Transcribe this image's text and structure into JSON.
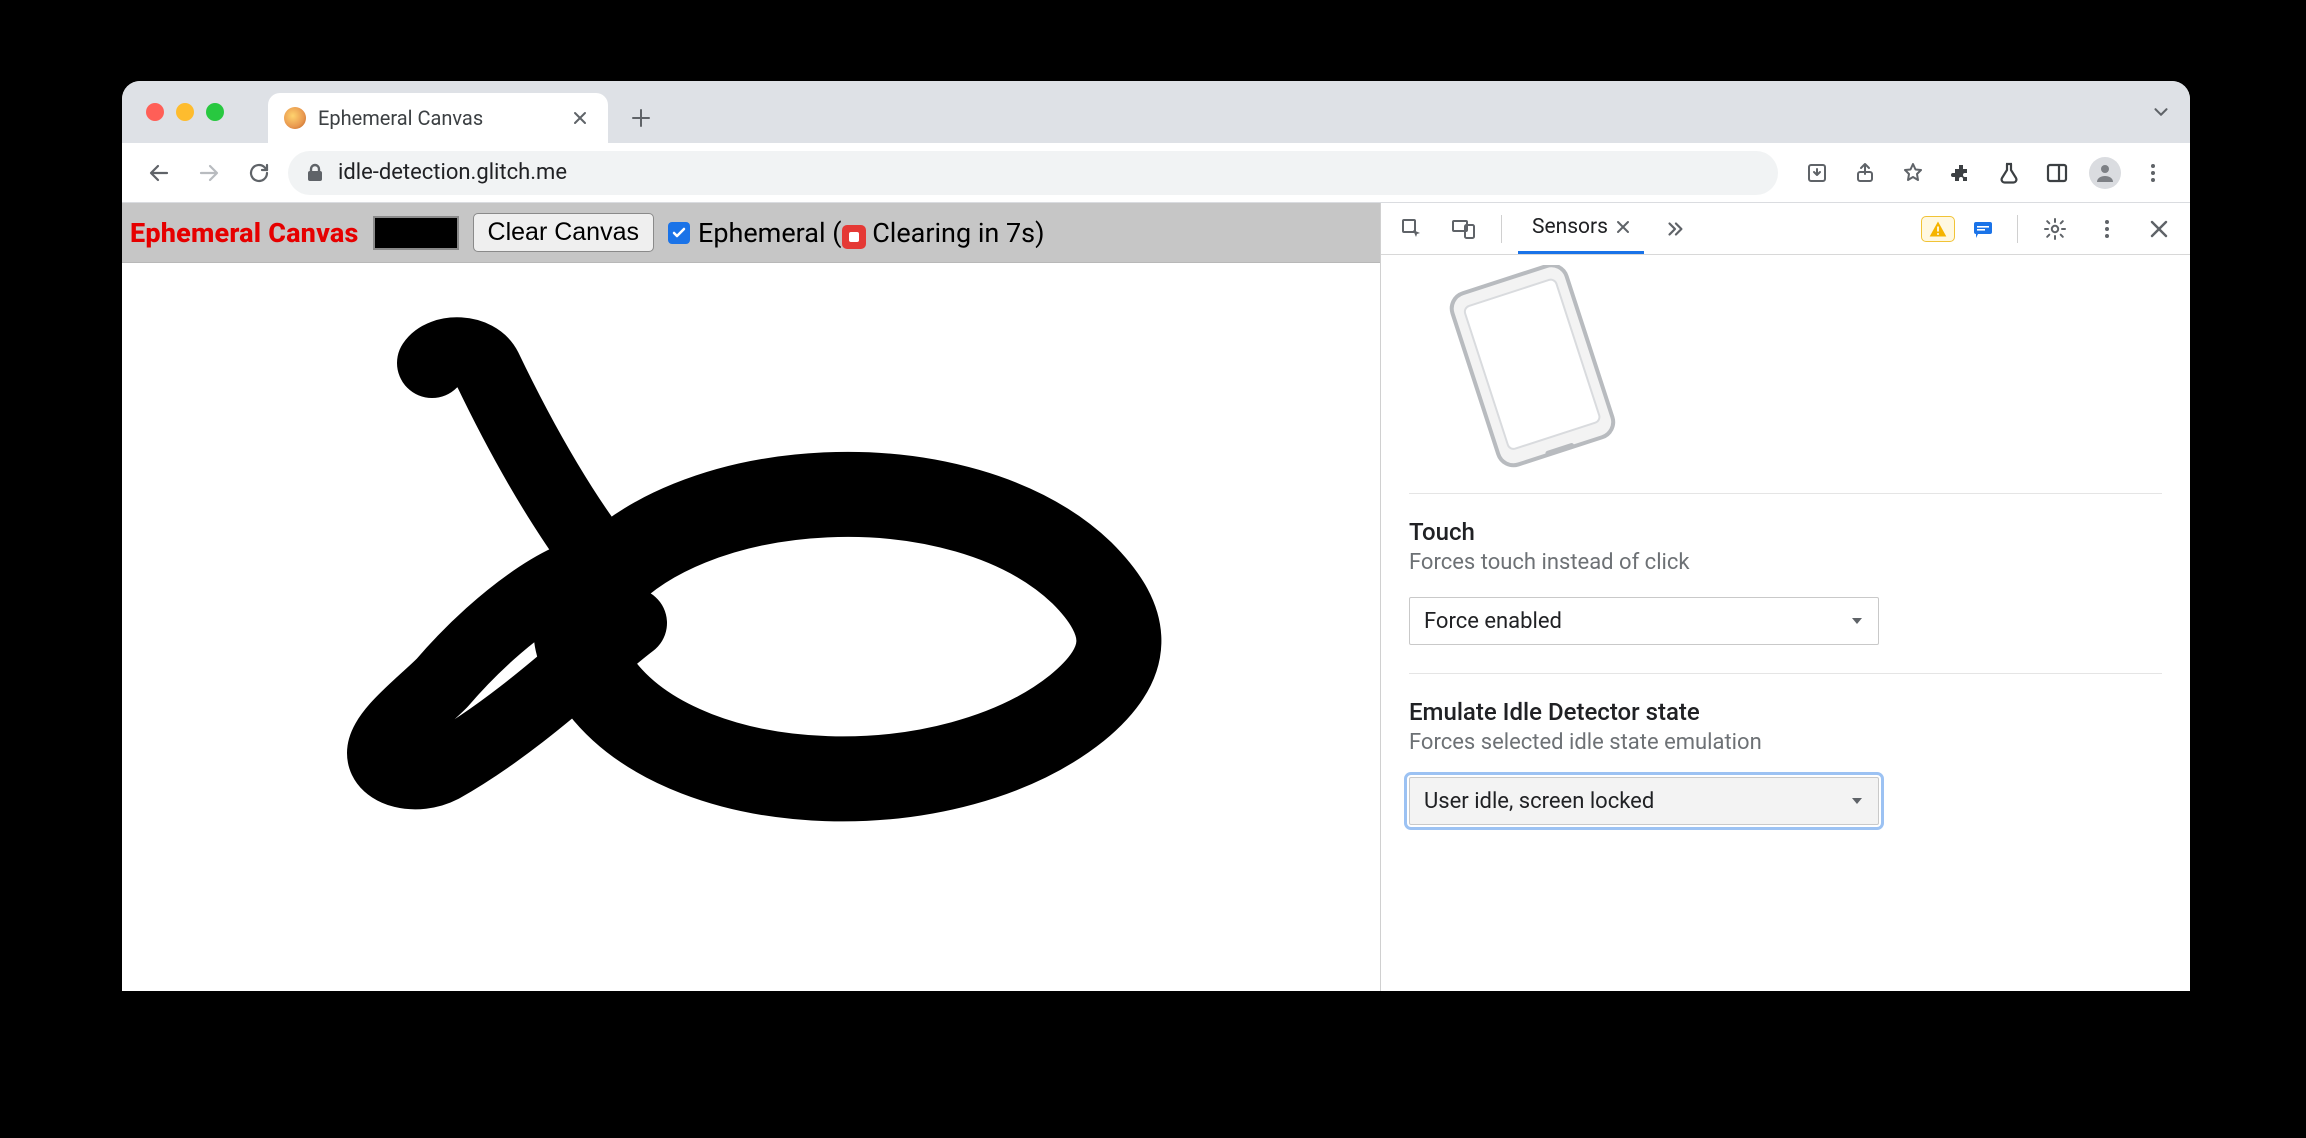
{
  "browser": {
    "tab_title": "Ephemeral Canvas",
    "url": "idle-detection.glitch.me"
  },
  "app": {
    "title": "Ephemeral Canvas",
    "clear_button": "Clear Canvas",
    "ephemeral_label_prefix": "Ephemeral (",
    "ephemeral_countdown": "Clearing in 7s",
    "ephemeral_label_suffix": ")",
    "color_swatch": "#000000",
    "ephemeral_checked": true
  },
  "devtools": {
    "active_tab": "Sensors",
    "touch": {
      "title": "Touch",
      "desc": "Forces touch instead of click",
      "value": "Force enabled"
    },
    "idle": {
      "title": "Emulate Idle Detector state",
      "desc": "Forces selected idle state emulation",
      "value": "User idle, screen locked"
    }
  }
}
